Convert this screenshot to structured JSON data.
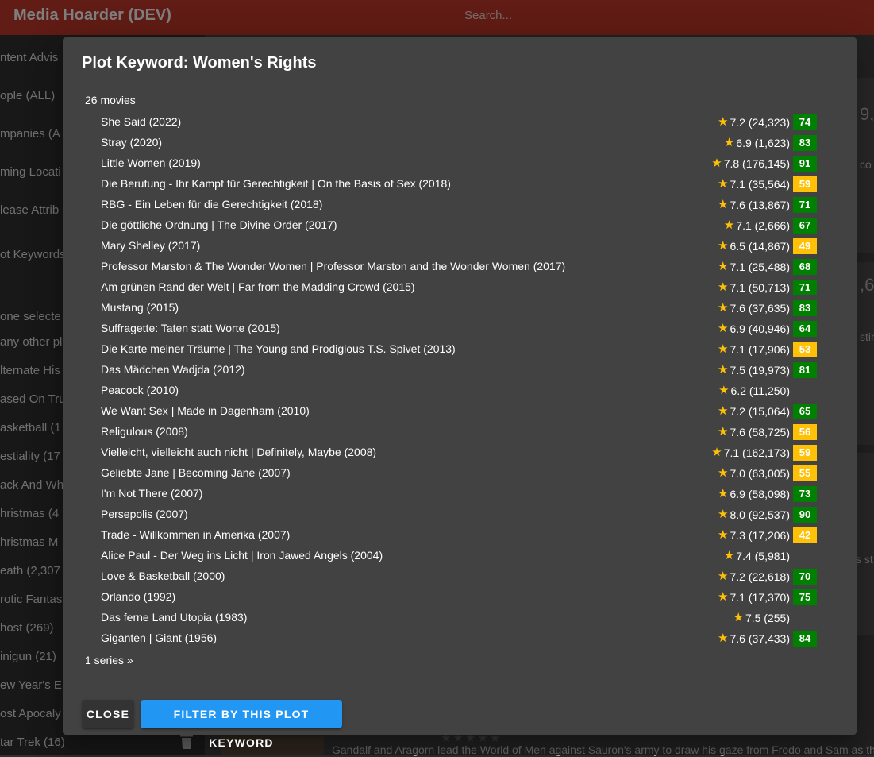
{
  "app": {
    "title": "Media Hoarder (DEV)",
    "search_placeholder": "Search..."
  },
  "sidebar": {
    "items": [
      "ntent Advis",
      "ople (ALL)",
      "mpanies (A",
      "ming Locati",
      "lease Attrib",
      "ot Keywords",
      "one selecte",
      "any other pl",
      "lternate His",
      "ased On Tru",
      "asketball (1",
      "estiality (17",
      "ack And Wh",
      "hristmas (4",
      "hristmas M",
      "eath (2,307",
      "rotic Fantas",
      "host (269)",
      "inigun (21)",
      "ew Year's E",
      "ost Apocaly",
      "tar Trek (16)"
    ]
  },
  "background": {
    "big_1": "9,",
    "text_1": "co",
    "big_2": ",6",
    "text_2": "stin",
    "text_3": "s st",
    "text_4": ")",
    "description": "Gandalf and Aragorn lead the World of Men against Sauron's army to draw his gaze from Frodo and Sam as the"
  },
  "dialog": {
    "title": "Plot Keyword: Women's Rights",
    "movie_count": "26 movies",
    "series_link": "1 series »",
    "close_label": "Close",
    "filter_label": "Filter by this Plot Keyword",
    "colors": {
      "meta_green": "#008000",
      "meta_yellow": "#ffc107",
      "star": "#ffc107",
      "primary": "#2196f3"
    },
    "movies": [
      {
        "title": "She Said (2022)",
        "rating": "7.2 (24,323)",
        "meta": "74",
        "meta_color": "green"
      },
      {
        "title": "Stray (2020)",
        "rating": "6.9 (1,623)",
        "meta": "83",
        "meta_color": "green"
      },
      {
        "title": "Little Women (2019)",
        "rating": "7.8 (176,145)",
        "meta": "91",
        "meta_color": "green"
      },
      {
        "title": "Die Berufung - Ihr Kampf für Gerechtigkeit | On the Basis of Sex (2018)",
        "rating": "7.1 (35,564)",
        "meta": "59",
        "meta_color": "yellow"
      },
      {
        "title": "RBG - Ein Leben für die Gerechtigkeit (2018)",
        "rating": "7.6 (13,867)",
        "meta": "71",
        "meta_color": "green"
      },
      {
        "title": "Die göttliche Ordnung | The Divine Order (2017)",
        "rating": "7.1 (2,666)",
        "meta": "67",
        "meta_color": "green"
      },
      {
        "title": "Mary Shelley (2017)",
        "rating": "6.5 (14,867)",
        "meta": "49",
        "meta_color": "yellow"
      },
      {
        "title": "Professor Marston & The Wonder Women | Professor Marston and the Wonder Women (2017)",
        "rating": "7.1 (25,488)",
        "meta": "68",
        "meta_color": "green"
      },
      {
        "title": "Am grünen Rand der Welt | Far from the Madding Crowd (2015)",
        "rating": "7.1 (50,713)",
        "meta": "71",
        "meta_color": "green"
      },
      {
        "title": "Mustang (2015)",
        "rating": "7.6 (37,635)",
        "meta": "83",
        "meta_color": "green"
      },
      {
        "title": "Suffragette: Taten statt Worte (2015)",
        "rating": "6.9 (40,946)",
        "meta": "64",
        "meta_color": "green"
      },
      {
        "title": "Die Karte meiner Träume | The Young and Prodigious T.S. Spivet (2013)",
        "rating": "7.1 (17,906)",
        "meta": "53",
        "meta_color": "yellow"
      },
      {
        "title": "Das Mädchen Wadjda (2012)",
        "rating": "7.5 (19,973)",
        "meta": "81",
        "meta_color": "green"
      },
      {
        "title": "Peacock (2010)",
        "rating": "6.2 (11,250)",
        "meta": "",
        "meta_color": ""
      },
      {
        "title": "We Want Sex | Made in Dagenham (2010)",
        "rating": "7.2 (15,064)",
        "meta": "65",
        "meta_color": "green"
      },
      {
        "title": "Religulous (2008)",
        "rating": "7.6 (58,725)",
        "meta": "56",
        "meta_color": "yellow"
      },
      {
        "title": "Vielleicht, vielleicht auch nicht | Definitely, Maybe (2008)",
        "rating": "7.1 (162,173)",
        "meta": "59",
        "meta_color": "yellow"
      },
      {
        "title": "Geliebte Jane | Becoming Jane (2007)",
        "rating": "7.0 (63,005)",
        "meta": "55",
        "meta_color": "yellow"
      },
      {
        "title": "I'm Not There (2007)",
        "rating": "6.9 (58,098)",
        "meta": "73",
        "meta_color": "green"
      },
      {
        "title": "Persepolis (2007)",
        "rating": "8.0 (92,537)",
        "meta": "90",
        "meta_color": "green"
      },
      {
        "title": "Trade - Willkommen in Amerika (2007)",
        "rating": "7.3 (17,206)",
        "meta": "42",
        "meta_color": "yellow"
      },
      {
        "title": "Alice Paul - Der Weg ins Licht | Iron Jawed Angels (2004)",
        "rating": "7.4 (5,981)",
        "meta": "",
        "meta_color": ""
      },
      {
        "title": "Love & Basketball (2000)",
        "rating": "7.2 (22,618)",
        "meta": "70",
        "meta_color": "green"
      },
      {
        "title": "Orlando (1992)",
        "rating": "7.1 (17,370)",
        "meta": "75",
        "meta_color": "green"
      },
      {
        "title": "Das ferne Land Utopia (1983)",
        "rating": "7.5 (255)",
        "meta": "",
        "meta_color": ""
      },
      {
        "title": "Giganten | Giant (1956)",
        "rating": "7.6 (37,433)",
        "meta": "84",
        "meta_color": "green"
      }
    ]
  }
}
